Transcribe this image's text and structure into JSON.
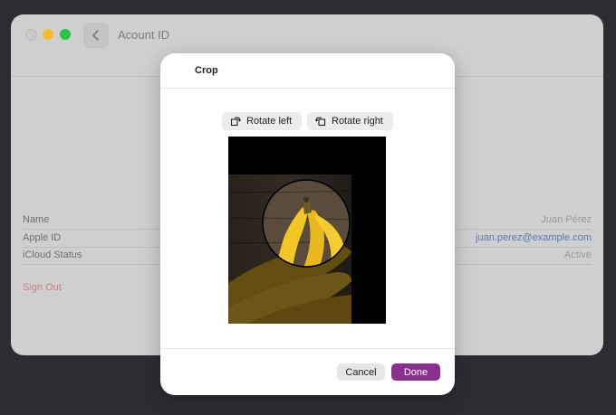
{
  "window": {
    "title": "Acount ID",
    "fields": [
      {
        "label": "Name",
        "value": "Juan Pérez"
      },
      {
        "label": "Apple ID",
        "value": "juan.perez@example.com"
      },
      {
        "label": "iCloud Status",
        "value": "Active"
      }
    ],
    "sign_out": "Sign Out"
  },
  "modal": {
    "title": "Crop",
    "rotate_left": "Rotate left",
    "rotate_right": "Rotate right",
    "image_icon": "bananas-photo",
    "cancel": "Cancel",
    "done": "Done"
  },
  "colors": {
    "accent": "#8b2f8c",
    "link": "#5a78b5",
    "danger": "#cf7f86"
  }
}
